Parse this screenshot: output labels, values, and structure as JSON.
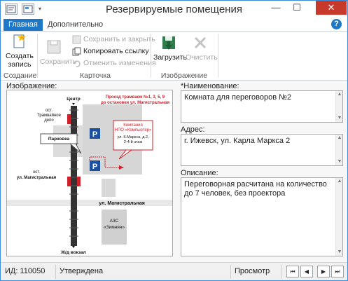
{
  "window": {
    "title": "Резервируемые помещения"
  },
  "window_controls": {
    "minimize": "—",
    "maximize": "☐",
    "close": "✕"
  },
  "tabs": [
    {
      "label": "Главная"
    },
    {
      "label": "Дополнительно"
    }
  ],
  "help": "?",
  "ribbon": {
    "create_label": "Создать запись",
    "save_label": "Сохранить",
    "save_close_label": "Сохранить и закрыть",
    "copy_link_label": "Копировать ссылку",
    "cancel_changes_label": "Отменить изменения",
    "load_label": "Загрузить",
    "clear_label": "Очистить",
    "groups": {
      "create": "Создание",
      "card": "Карточка",
      "image": "Изображение"
    }
  },
  "form": {
    "image_label": "Изображение:",
    "name_label": "*Наименование:",
    "name_value": "Комната для переговоров №2",
    "address_label": "Адрес:",
    "address_value": "г. Ижевск, ул. Карла Маркса 2",
    "description_label": "Описание:",
    "description_value": "Переговорная расчитана на количество до 7 человек, без проектора"
  },
  "map": {
    "center": "Центр",
    "tram_route": "Проезд трамваем №1, 3, 5, 9",
    "tram_route2": "до остановки ул. Магистральная",
    "stop_depot1": "ост.",
    "stop_depot2": "Трамвайное",
    "stop_depot3": "депо",
    "parking": "Парковка",
    "company1": "Компания",
    "company2": "НПО «Компьютер»",
    "company3": "ул. К.Маркса, д.2,",
    "company4": "2-4-й этаж",
    "stop_mag1": "ост.",
    "stop_mag2": "ул. Магистральная",
    "street": "ул. Магистральная",
    "gas1": "АЗС",
    "gas2": "«Зимняя»",
    "railway": "Ж/д вокзал",
    "p": "P"
  },
  "status": {
    "id_text": "ИД: 110050",
    "state": "Утверждена",
    "mode": "Просмотр",
    "nav_first": "⏮",
    "nav_prev": "◀",
    "nav_next": "▶",
    "nav_last": "⏭"
  },
  "colors": {
    "accent": "#1e78c8",
    "close": "#c7392b",
    "map_red": "#d0202a"
  }
}
